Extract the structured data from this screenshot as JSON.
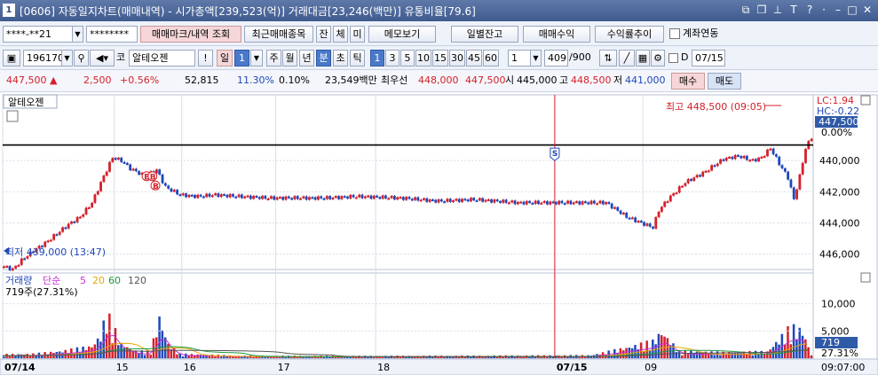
{
  "title_bar": {
    "window_number": "1",
    "title": "[0606] 자동일지차트(매매내역) - 시가총액[239,523(억)] 거래대금[23,246(백만)] 유통비율[79.6]"
  },
  "toolbar1": {
    "account_value": "****-**21",
    "password_value": "********",
    "trade_mark_button": "매매마크/내역 조회",
    "recent_stocks_button": "최근매매종목",
    "balance_button": "잔",
    "fill_button": "체",
    "unfilled_button": "미",
    "memo_button": "메모보기",
    "daily_balance_button": "일별잔고",
    "trade_profit_button": "매매수익",
    "yield_trend_button": "수익률추이",
    "account_link_label": "계좌연동"
  },
  "toolbar2": {
    "stock_code": "196170",
    "market_prefix": "코",
    "stock_name": "알테오젠",
    "alert_label": "!",
    "period_label": "일",
    "period_value": "1",
    "period_tabs": [
      "주",
      "월",
      "년",
      "분",
      "초",
      "틱"
    ],
    "interval_options": [
      "1",
      "3",
      "5",
      "10",
      "15",
      "30",
      "45",
      "60"
    ],
    "interval_input": "1",
    "count_value": "409",
    "count_total": "/900",
    "d_label": "D",
    "date_value": "07/15"
  },
  "quote_bar": {
    "price": "447,500",
    "change": "2,500",
    "change_pct": "+0.56%",
    "volume": "52,815",
    "turnover_rate": "11.30%",
    "ratio": "0.10%",
    "amount": "23,549백만",
    "best_quote_label": "최우선",
    "best_ask": "448,000",
    "best_bid": "447,500",
    "open_label": "시",
    "open": "445,000",
    "high_label": "고",
    "high": "448,500",
    "low_label": "저",
    "low": "441,000",
    "buy_button": "매수",
    "sell_button": "매도"
  },
  "chart": {
    "stock_label": "알테오젠",
    "lc_label": "LC:1.94",
    "hc_label": "HC:-0.22",
    "current_price_tag": "447,500",
    "ratio_tag": "0.00%",
    "high_annotation": "최고 448,500 (09:05)",
    "low_annotation": "최저 439,000 (13:47)",
    "price_ticks": [
      "446,000",
      "444,000",
      "442,000",
      "440,000"
    ],
    "volume_legend": {
      "label": "거래량",
      "ma_label": "단순",
      "ma_periods": [
        "5",
        "20",
        "60",
        "120"
      ]
    },
    "volume_value_label": "719주(27.31%)",
    "volume_ticks": [
      "10,000",
      "5,000"
    ],
    "volume_current_tag": "719",
    "volume_pct_tag": "27.31%",
    "time_ticks": [
      "07/14",
      "15",
      "16",
      "17",
      "18",
      "07/15",
      "09"
    ],
    "clock": "09:07:00",
    "markers": [
      "B",
      "B",
      "B",
      "S"
    ]
  },
  "chart_data": {
    "type": "candlestick",
    "title": "",
    "ylim": [
      439000,
      449200
    ],
    "yticks": [
      440000,
      442000,
      444000,
      446000
    ],
    "current": 447500,
    "high": 448500,
    "low": 439000,
    "close_path": [
      [
        0,
        439200
      ],
      [
        3,
        439000
      ],
      [
        6,
        439600
      ],
      [
        10,
        440200
      ],
      [
        14,
        440700
      ],
      [
        18,
        441300
      ],
      [
        22,
        441900
      ],
      [
        26,
        442400
      ],
      [
        30,
        443300
      ],
      [
        34,
        445000
      ],
      [
        37,
        446200
      ],
      [
        40,
        446000
      ],
      [
        43,
        445500
      ],
      [
        48,
        445000
      ],
      [
        52,
        445400
      ],
      [
        55,
        444300
      ],
      [
        60,
        443800
      ],
      [
        66,
        443700
      ],
      [
        72,
        443800
      ],
      [
        80,
        443700
      ],
      [
        90,
        443600
      ],
      [
        100,
        443600
      ],
      [
        110,
        443600
      ],
      [
        120,
        443700
      ],
      [
        135,
        443600
      ],
      [
        148,
        443400
      ],
      [
        160,
        443500
      ],
      [
        175,
        443300
      ],
      [
        190,
        443300
      ],
      [
        205,
        443300
      ],
      [
        212,
        442400
      ],
      [
        217,
        442000
      ],
      [
        221,
        441700
      ],
      [
        223,
        442800
      ],
      [
        226,
        443500
      ],
      [
        232,
        444600
      ],
      [
        238,
        445200
      ],
      [
        245,
        446100
      ],
      [
        250,
        446300
      ],
      [
        255,
        446000
      ],
      [
        258,
        446200
      ],
      [
        261,
        446800
      ],
      [
        264,
        445800
      ],
      [
        267,
        444900
      ],
      [
        269,
        443500
      ],
      [
        271,
        445000
      ],
      [
        273,
        446800
      ],
      [
        275,
        447500
      ]
    ],
    "volume_path": [
      [
        0,
        800
      ],
      [
        10,
        900
      ],
      [
        20,
        1500
      ],
      [
        30,
        2500
      ],
      [
        33,
        4800
      ],
      [
        35,
        9500
      ],
      [
        40,
        3000
      ],
      [
        45,
        1500
      ],
      [
        50,
        1400
      ],
      [
        53,
        8500
      ],
      [
        56,
        3000
      ],
      [
        60,
        900
      ],
      [
        80,
        500
      ],
      [
        120,
        450
      ],
      [
        160,
        500
      ],
      [
        200,
        600
      ],
      [
        212,
        2200
      ],
      [
        221,
        3500
      ],
      [
        224,
        5600
      ],
      [
        230,
        1500
      ],
      [
        245,
        1200
      ],
      [
        260,
        1400
      ],
      [
        268,
        6500
      ],
      [
        272,
        5800
      ],
      [
        275,
        719
      ]
    ]
  }
}
